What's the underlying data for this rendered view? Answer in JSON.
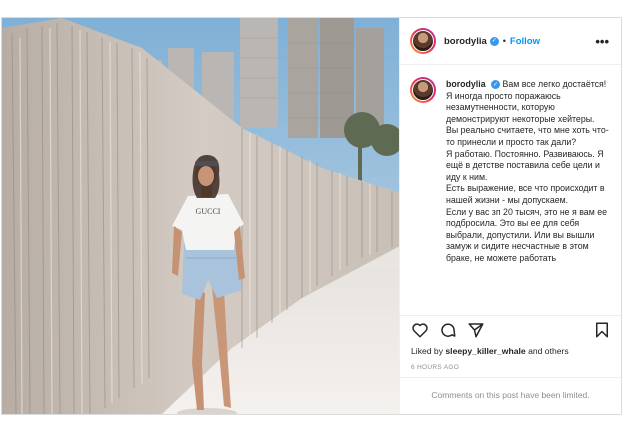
{
  "post": {
    "username": "borodylia",
    "follow_label": "Follow",
    "more_label": "•••",
    "separator": "•",
    "caption_text": "Вам все легко достаётся!\nЯ иногда просто поражаюсь незамутненности, которую демонстрируют некоторые хейтеры.\nВы реально считаете, что мне хоть что-то принесли и просто так дали?\nЯ работаю. Постоянно. Развиваюсь. Я ещё в детстве поставила себе цели и иду к ним.\nЕсть выражение, все что происходит в нашей жизни - мы допускаем.\nЕсли у вас зп 20 тысяч, это не я вам ее подбросила. Это вы ее для себя выбрали, допустили. Или вы вышли замуж и сидите несчастные в этом браке, не можете работать",
    "likes_prefix": "Liked by",
    "likes_user": "sleepy_killer_whale",
    "likes_suffix": "and others",
    "time_ago": "6 HOURS AGO",
    "comments_limited": "Comments on this post have been limited.",
    "shirt_text": "GUCCI"
  },
  "icons": {
    "like": "heart-icon",
    "comment": "comment-icon",
    "share": "share-icon",
    "save": "bookmark-icon",
    "verified": "verified-badge-icon"
  },
  "colors": {
    "link_blue": "#0095f6",
    "verified_blue": "#3897f0",
    "muted": "#8e8e8e",
    "text": "#262626"
  }
}
